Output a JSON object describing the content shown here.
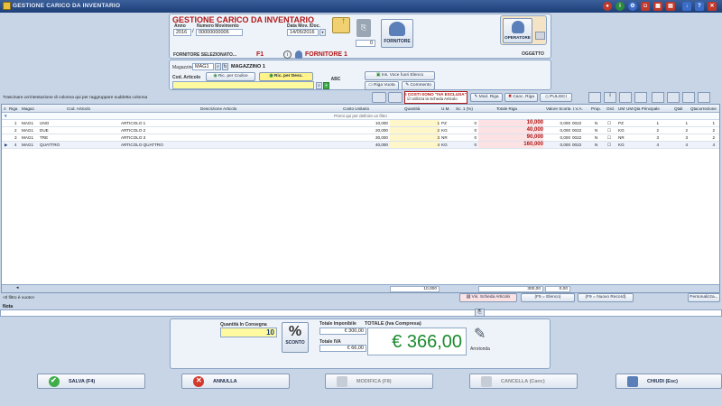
{
  "window": {
    "title": "GESTIONE CARICO DA INVENTARIO"
  },
  "header": {
    "title": "GESTIONE CARICO DA INVENTARIO",
    "anno_label": "Anno",
    "anno": "2016",
    "numero_label": "Numero Movimento",
    "numero": "00000000006",
    "data_label": "Data Mov. /Doc.",
    "data": "14/05/2016",
    "counter": "0",
    "fornitore_button": "FORNITORE",
    "operatore_button": "OPERATORE",
    "fornitore_sel_label": "FORNITORE SELEZIONATO...",
    "fornitore_code": "F1",
    "fornitore_name": "FORNITORE 1",
    "oggetto_label": "OGGETTO"
  },
  "articolo": {
    "magazzino_label": "Magazzino",
    "magazzino_code": "MAG1",
    "magazzino_name": "MAGAZZINO 1",
    "cod_articolo_label": "Cod. Articolo",
    "ric_codice": "Ric. per Codice",
    "ric_desc": "Ric. per Desc.",
    "abc": "ABC",
    "ins_voce": "Ins. Voce fuori Elenco",
    "riga_vuota": "Riga Vuota",
    "commento": "Commento"
  },
  "toolbar": {
    "group_hint": "Trascinare un'intestazione di colonna qui per raggruppare suddetta colonna",
    "costi_title": "I COSTI SONO \"IVA ESCLUSA\"",
    "utilizza_scheda": "Utilizza la Scheda Articolo",
    "mod_riga": "Mod. Riga",
    "canc_riga": "Canc. Riga",
    "pulisci": "PULISCI"
  },
  "grid": {
    "columns": [
      "Riga",
      "Magaz.",
      "Cod. Articolo",
      "Descrizione Articolo",
      "Costo Unitario",
      "Quantità",
      "U.M.",
      "Sc. 1 (%)",
      "Totale Riga",
      "Valore Scorta",
      "I.V.A.",
      "Prop.",
      "Ord.",
      "UM",
      "UM",
      "Qta Principale",
      "Qtali",
      "Qtacorrezione"
    ],
    "filter_hint": "Premi qui per definire un filtro",
    "rows": [
      {
        "n": "1",
        "mag": "MAG1",
        "cod": "UNO",
        "desc": "ARTICOLO 1",
        "costo": "10,000",
        "qta": "1",
        "um": "PZ",
        "sc": "0",
        "tot": "10,000",
        "vs": "0,000",
        "iva": "0022",
        "prop": "N",
        "um2": "PZ",
        "qp": "1",
        "qt": "1",
        "qc": "1"
      },
      {
        "n": "2",
        "mag": "MAG1",
        "cod": "DUE",
        "desc": "ARTICOLO 2",
        "costo": "20,000",
        "qta": "2",
        "um": "KG",
        "sc": "0",
        "tot": "40,000",
        "vs": "0,000",
        "iva": "0022",
        "prop": "N",
        "um2": "KG",
        "qp": "2",
        "qt": "2",
        "qc": "2"
      },
      {
        "n": "3",
        "mag": "MAG1",
        "cod": "TRE",
        "desc": "ARTICOLO 3",
        "costo": "30,000",
        "qta": "3",
        "um": "NR",
        "sc": "0",
        "tot": "90,000",
        "vs": "0,000",
        "iva": "0022",
        "prop": "N",
        "um2": "NR",
        "qp": "3",
        "qt": "3",
        "qc": "2"
      },
      {
        "n": "4",
        "mag": "MAG1",
        "cod": "QUATTRO",
        "desc": "ARTICOLO QUATTRO",
        "costo": "40,000",
        "qta": "4",
        "um": "KG",
        "sc": "0",
        "tot": "160,000",
        "vs": "0,000",
        "iva": "0022",
        "prop": "N",
        "um2": "KG",
        "qp": "4",
        "qt": "4",
        "qc": "4"
      }
    ],
    "sum_costo": "10,000",
    "sum_tot": "300,00",
    "sum_vs": "0,00"
  },
  "statusbar": {
    "filter_text": "<Il filtro è vuoto>",
    "vis_scheda": "Vis. Scheda Articolo",
    "f5": "(F5 = Elenco)",
    "f9": "(F9 = Nuovo Record)",
    "personalizza": "Personalizza...",
    "nota_label": "Nota"
  },
  "totals": {
    "qta_label": "Quantità In Consegna",
    "qta_value": "10",
    "sconto_button": "SCONTO",
    "imponibile_label": "Totale Imponibile",
    "imponibile_value": "€ 300,00",
    "iva_label": "Totale IVA",
    "iva_value": "€ 66,00",
    "totale_label": "TOTALE (Iva Compresa)",
    "totale_value": "€ 366,00",
    "arrotonda": "Arrotonda"
  },
  "footer": {
    "salva": "SALVA (F4)",
    "annulla": "ANNULLA",
    "modifica": "MODIFICA (F8)",
    "cancella": "CANCELLA (Canc)",
    "chiudi": "CHIUDI (Esc)"
  },
  "colors": {
    "titlebar": "#1e3f78",
    "accent": "#c0392b",
    "total_green": "#1a8a2e",
    "highlight_yellow": "#fff7c9",
    "highlight_pink": "#fde2e4"
  }
}
